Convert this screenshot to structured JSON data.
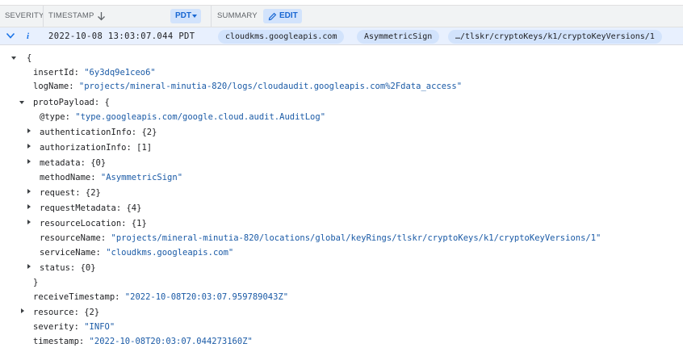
{
  "header": {
    "severity": "SEVERITY",
    "timestamp": "TIMESTAMP",
    "timezone": "PDT",
    "summary": "SUMMARY",
    "edit": "EDIT"
  },
  "log_row": {
    "timestamp": "2022-10-08 13:03:07.044 PDT",
    "severity_glyph": "i",
    "chips": [
      "cloudkms.googleapis.com",
      "AsymmetricSign",
      "…/tlskr/cryptoKeys/k1/cryptoKeyVersions/1"
    ]
  },
  "tree": {
    "open_root": "{",
    "insertId": {
      "key": "insertId:",
      "value": "\"6y3dq9e1ceo6\""
    },
    "logName": {
      "key": "logName:",
      "value": "\"projects/mineral-minutia-820/logs/cloudaudit.googleapis.com%2Fdata_access\""
    },
    "protoPayload": {
      "key": "protoPayload:",
      "value": "{"
    },
    "type": {
      "key": "@type:",
      "value": "\"type.googleapis.com/google.cloud.audit.AuditLog\""
    },
    "authenticationInfo": {
      "key": "authenticationInfo:",
      "value": "{2}"
    },
    "authorizationInfo": {
      "key": "authorizationInfo:",
      "value": "[1]"
    },
    "metadata": {
      "key": "metadata:",
      "value": "{0}"
    },
    "methodName": {
      "key": "methodName:",
      "value": "\"AsymmetricSign\""
    },
    "request": {
      "key": "request:",
      "value": "{2}"
    },
    "requestMetadata": {
      "key": "requestMetadata:",
      "value": "{4}"
    },
    "resourceLocation": {
      "key": "resourceLocation:",
      "value": "{1}"
    },
    "resourceName": {
      "key": "resourceName:",
      "value": "\"projects/mineral-minutia-820/locations/global/keyRings/tlskr/cryptoKeys/k1/cryptoKeyVersions/1\""
    },
    "serviceName": {
      "key": "serviceName:",
      "value": "\"cloudkms.googleapis.com\""
    },
    "status": {
      "key": "status:",
      "value": "{0}"
    },
    "close_proto": "}",
    "receiveTimestamp": {
      "key": "receiveTimestamp:",
      "value": "\"2022-10-08T20:03:07.959789043Z\""
    },
    "resource": {
      "key": "resource:",
      "value": "{2}"
    },
    "severity": {
      "key": "severity:",
      "value": "\"INFO\""
    },
    "timestamp": {
      "key": "timestamp:",
      "value": "\"2022-10-08T20:03:07.044273160Z\""
    }
  },
  "colors": {
    "accent": "#1a73e8",
    "chip_bg": "#d2e3fc",
    "row_bg": "#e8f0fe",
    "string_value": "#1a5aa6"
  }
}
